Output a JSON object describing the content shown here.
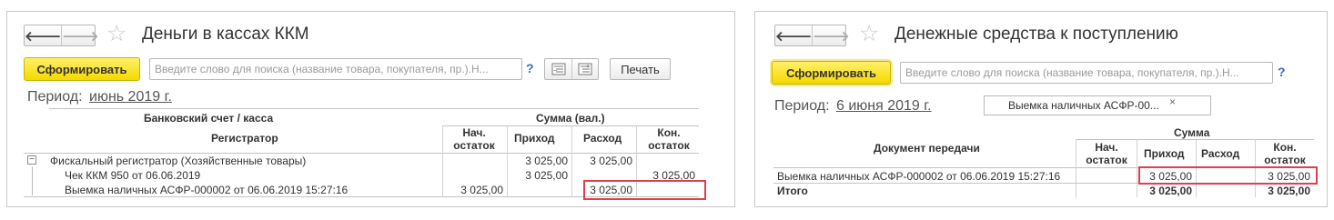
{
  "left": {
    "nav": {
      "back": "🡐",
      "forward": "🡒"
    },
    "title": "Деньги в кассах ККМ",
    "generate_label": "Сформировать",
    "search_placeholder": "Введите слово для поиска (название товара, покупателя, пр.).Н...",
    "help": "?",
    "print_label": "Печать",
    "period_label": "Период:",
    "period_value": "июнь 2019 г.",
    "headers": {
      "account": "Банковский счет / касса",
      "sum": "Сумма (вал.)",
      "register": "Регистратор",
      "opening": "Нач. остаток",
      "income": "Приход",
      "expense": "Расход",
      "closing": "Кон. остаток"
    },
    "tree_toggle": "−",
    "rows": [
      {
        "name": "Фискальный регистратор (Хозяйственные товары)",
        "opening": "",
        "income": "3 025,00",
        "expense": "3 025,00",
        "closing": ""
      },
      {
        "name": "Чек ККМ 950 от 06.06.2019",
        "opening": "",
        "income": "3 025,00",
        "expense": "",
        "closing": "3 025,00"
      },
      {
        "name": "Выемка наличных АСФР-000002 от 06.06.2019 15:27:16",
        "opening": "3 025,00",
        "income": "",
        "expense": "3 025,00",
        "closing": ""
      }
    ]
  },
  "right": {
    "nav": {
      "back": "🡐",
      "forward": "🡒"
    },
    "title": "Денежные средства к поступлению",
    "generate_label": "Сформировать",
    "search_placeholder": "Введите слово для поиска (название товара, покупателя, пр.).Н...",
    "help": "?",
    "period_label": "Период:",
    "period_value": "6 июня 2019 г.",
    "filter_value": "Выемка наличных АСФР-00...",
    "filter_clear": "×",
    "headers": {
      "sum": "Сумма",
      "document": "Документ передачи",
      "opening": "Нач. остаток",
      "income": "Приход",
      "expense": "Расход",
      "closing": "Кон. остаток"
    },
    "rows": [
      {
        "name": "Выемка наличных АСФР-000002 от 06.06.2019 15:27:16",
        "opening": "",
        "income": "3 025,00",
        "expense": "",
        "closing": "3 025,00"
      }
    ],
    "total": {
      "name": "Итого",
      "opening": "",
      "income": "3 025,00",
      "expense": "",
      "closing": "3 025,00"
    }
  },
  "colors": {
    "accent_yellow": "#f5d900",
    "highlight_red": "#e0404c",
    "link_gray": "#555555"
  }
}
